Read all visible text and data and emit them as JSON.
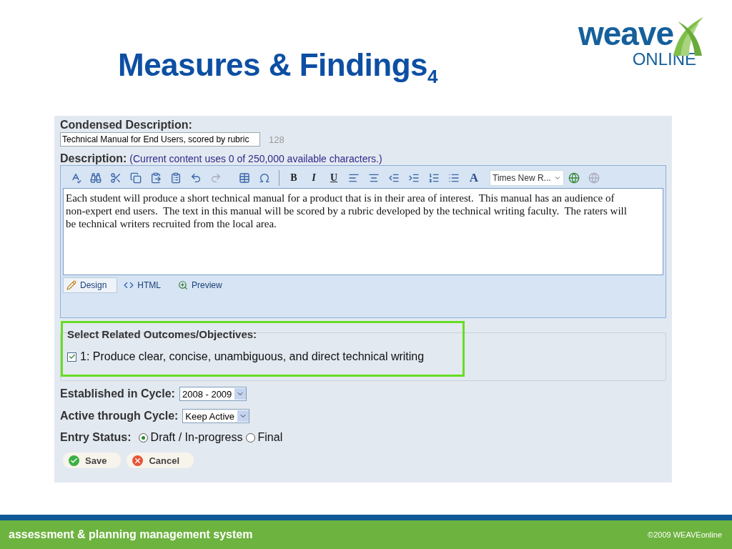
{
  "slide": {
    "title": "Measures & Findings$_{4}$",
    "logo": {
      "word": "weave",
      "subword": "ONLINE"
    }
  },
  "form": {
    "condensed": {
      "label": "Condensed Description:",
      "value": "Technical Manual for End Users, scored by rubric",
      "count": "128"
    },
    "description": {
      "label": "Description:",
      "note": "(Current content uses 0 of 250,000 available characters.)",
      "format_buttons": [
        "B",
        "I",
        "U"
      ],
      "color_button": "A",
      "redo": {
        "disabled": true
      },
      "font": "Times New R...",
      "text": "Each student will produce a short technical manual for a product that is in their area of interest.  This manual has an audience of non-expert end users.  The text in this manual will be scored by a rubric developed by the technical writing faculty.  The raters will be technical writers recruited from the local area.",
      "modes": [
        {
          "label": "Design",
          "selected": true
        },
        {
          "label": "HTML",
          "selected": false
        },
        {
          "label": "Preview",
          "selected": false
        }
      ]
    },
    "outcomes": {
      "label": "Select Related Outcomes/Objectives:",
      "items": [
        {
          "label": "1: Produce clear, concise, unambiguous, and direct technical writing",
          "checked": true
        }
      ]
    },
    "established": {
      "label": "Established in Cycle:",
      "value": "2008 - 2009"
    },
    "active": {
      "label": "Active through Cycle:",
      "value": "Keep Active"
    },
    "status": {
      "label": "Entry Status:",
      "options": [
        {
          "label": "Draft / In-progress",
          "selected": true
        },
        {
          "label": "Final",
          "selected": false
        }
      ]
    },
    "buttons": [
      {
        "kind": "save",
        "label": "Save"
      },
      {
        "kind": "cancel",
        "label": "Cancel"
      }
    ]
  },
  "footer": {
    "tagline": "assessment & planning management system",
    "copyright": "©2009 WEAVEonline"
  }
}
